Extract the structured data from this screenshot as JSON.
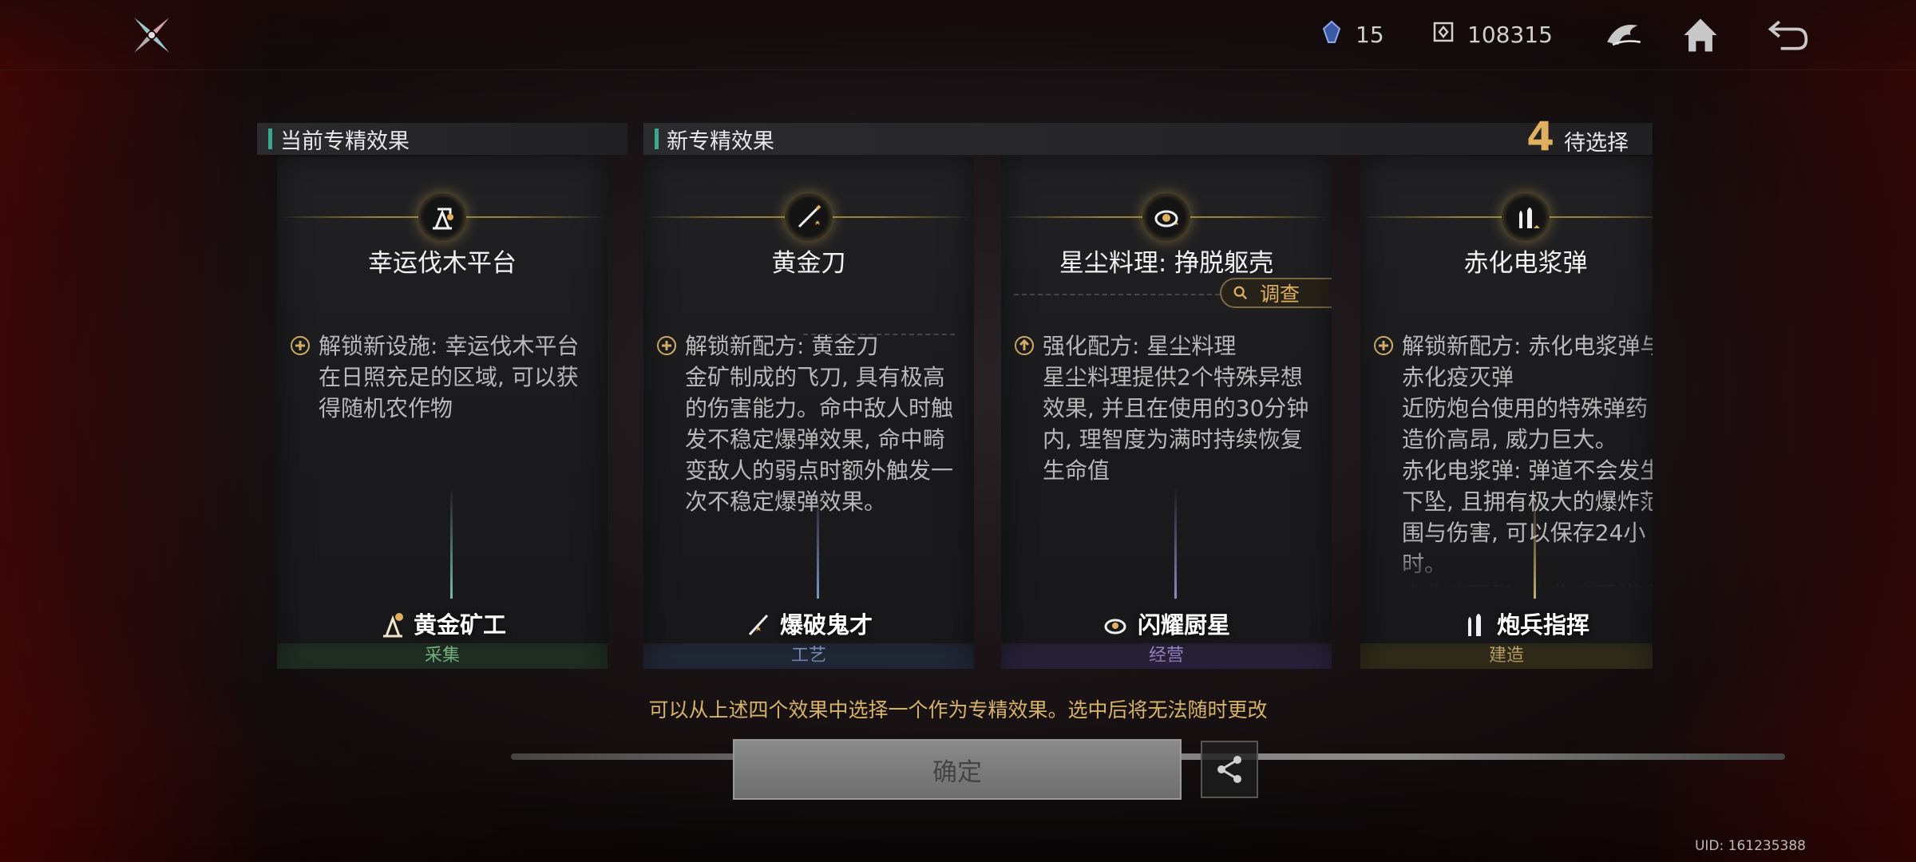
{
  "topbar": {
    "resources": [
      {
        "icon": "crystal-icon",
        "value": "15"
      },
      {
        "icon": "chip-icon",
        "value": "108315"
      }
    ]
  },
  "sections": {
    "current_title": "当前专精效果",
    "new_title": "新专精效果",
    "pending_count": "4",
    "pending_label": "待选择"
  },
  "cards": [
    {
      "name": "幸运伐木平台",
      "icon": "lumber-platform-icon",
      "desc": "解锁新设施: 幸运伐木平台\n在日照充足的区域, 可以获\n得随机农作物",
      "role": "黄金矿工",
      "category": "采集",
      "category_color": "green"
    },
    {
      "name": "黄金刀",
      "icon": "throwing-knife-icon",
      "desc": "解锁新配方: 黄金刀\n金矿制成的飞刀, 具有极高\n的伤害能力。命中敌人时触\n发不稳定爆弹效果, 命中畸\n变敌人的弱点时额外触发一\n次不稳定爆弹效果。",
      "role": "爆破鬼才",
      "category": "工艺",
      "category_color": "blue"
    },
    {
      "name": "星尘料理: 挣脱躯壳",
      "icon": "stardust-dish-icon",
      "desc": "强化配方: 星尘料理\n星尘料理提供2个特殊异想\n效果, 并且在使用的30分钟\n内, 理智度为满时持续恢复\n生命值",
      "role": "闪耀厨星",
      "category": "经营",
      "category_color": "purple",
      "investigate": "调查"
    },
    {
      "name": "赤化电浆弹",
      "icon": "plasma-shell-icon",
      "desc": "解锁新配方: 赤化电浆弹与\n赤化疫灭弹\n近防炮台使用的特殊弹药\n造价高昂, 威力巨大。\n赤化电浆弹: 弹道不会发生\n下坠, 且拥有极大的爆炸范\n围与伤害, 可以保存24小\n时。\n赤化疫灭弹: 赤化疫灭弹会",
      "role": "炮兵指挥",
      "category": "建造",
      "category_color": "gold"
    }
  ],
  "notice": "可以从上述四个效果中选择一个作为专精效果。选中后将无法随时更改",
  "confirm_label": "确定",
  "uid": "UID: 161235388",
  "colors": {
    "accent_gold": "#e0b060",
    "accent_teal": "#3aa88a"
  }
}
